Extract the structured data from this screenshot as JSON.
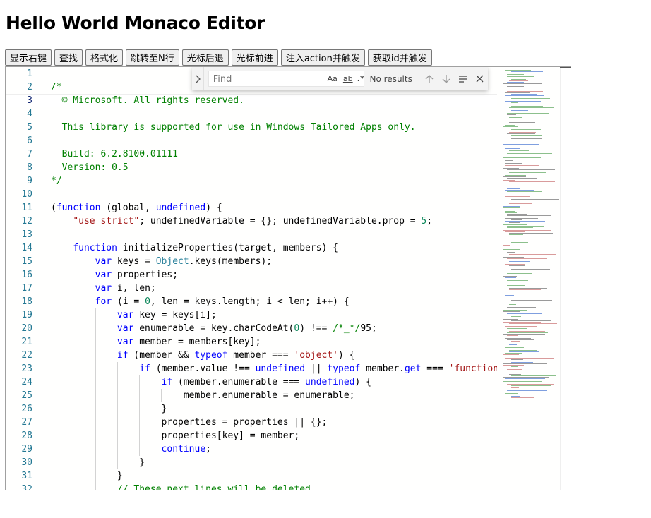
{
  "page": {
    "title": "Hello World Monaco Editor"
  },
  "toolbar": {
    "buttons": [
      {
        "label": "显示右键",
        "name": "show-context-menu-button"
      },
      {
        "label": "查找",
        "name": "find-button"
      },
      {
        "label": "格式化",
        "name": "format-button"
      },
      {
        "label": "跳转至N行",
        "name": "goto-line-button"
      },
      {
        "label": "光标后退",
        "name": "cursor-back-button"
      },
      {
        "label": "光标前进",
        "name": "cursor-forward-button"
      },
      {
        "label": "注入action并触发",
        "name": "inject-action-button"
      },
      {
        "label": "获取id并触发",
        "name": "get-id-trigger-button"
      }
    ]
  },
  "find_widget": {
    "placeholder": "Find",
    "match_case_label": "Aa",
    "whole_word_label": "ab",
    "regex_label": ".*",
    "result_text": "No results",
    "icons": [
      "chevron-right-icon",
      "arrow-up-icon",
      "arrow-down-icon",
      "selection-lines-icon",
      "close-icon"
    ]
  },
  "editor": {
    "language": "javascript",
    "current_line": 3,
    "lines": [
      {
        "n": "1",
        "indent": 0,
        "tokens": []
      },
      {
        "n": "2",
        "indent": 0,
        "tokens": [
          [
            "/*",
            "c"
          ]
        ]
      },
      {
        "n": "3",
        "indent": 0,
        "tokens": [
          [
            "  © Microsoft. All rights reserved.",
            "c"
          ]
        ]
      },
      {
        "n": "4",
        "indent": 0,
        "tokens": []
      },
      {
        "n": "5",
        "indent": 0,
        "tokens": [
          [
            "  This library is supported for use in Windows Tailored Apps only.",
            "c"
          ]
        ]
      },
      {
        "n": "6",
        "indent": 0,
        "tokens": []
      },
      {
        "n": "7",
        "indent": 0,
        "tokens": [
          [
            "  Build: 6.2.8100.01111",
            "c"
          ]
        ]
      },
      {
        "n": "8",
        "indent": 0,
        "tokens": [
          [
            "  Version: 0.5",
            "c"
          ]
        ]
      },
      {
        "n": "9",
        "indent": 0,
        "tokens": [
          [
            "*/",
            "c"
          ]
        ]
      },
      {
        "n": "10",
        "indent": 0,
        "tokens": []
      },
      {
        "n": "11",
        "indent": 0,
        "tokens": [
          [
            "(",
            ""
          ],
          [
            "function",
            "k"
          ],
          [
            " (global, ",
            ""
          ],
          [
            "undefined",
            "k"
          ],
          [
            ") {",
            ""
          ]
        ]
      },
      {
        "n": "12",
        "indent": 1,
        "tokens": [
          [
            "    ",
            ""
          ],
          [
            "\"use strict\"",
            "s"
          ],
          [
            "; undefinedVariable = {}; undefinedVariable.prop = ",
            ""
          ],
          [
            "5",
            "n"
          ],
          [
            ";",
            ""
          ]
        ]
      },
      {
        "n": "13",
        "indent": 1,
        "tokens": []
      },
      {
        "n": "14",
        "indent": 1,
        "tokens": [
          [
            "    ",
            ""
          ],
          [
            "function",
            "k"
          ],
          [
            " initializeProperties(target, members) {",
            ""
          ]
        ]
      },
      {
        "n": "15",
        "indent": 2,
        "tokens": [
          [
            "        ",
            ""
          ],
          [
            "var",
            "k"
          ],
          [
            " keys = ",
            ""
          ],
          [
            "Object",
            "t"
          ],
          [
            ".keys(members);",
            ""
          ]
        ]
      },
      {
        "n": "16",
        "indent": 2,
        "tokens": [
          [
            "        ",
            ""
          ],
          [
            "var",
            "k"
          ],
          [
            " properties;",
            ""
          ]
        ]
      },
      {
        "n": "17",
        "indent": 2,
        "tokens": [
          [
            "        ",
            ""
          ],
          [
            "var",
            "k"
          ],
          [
            " i, len;",
            ""
          ]
        ]
      },
      {
        "n": "18",
        "indent": 2,
        "tokens": [
          [
            "        ",
            ""
          ],
          [
            "for",
            "k"
          ],
          [
            " (i = ",
            ""
          ],
          [
            "0",
            "n"
          ],
          [
            ", len = keys.length; i < len; i++) {",
            ""
          ]
        ]
      },
      {
        "n": "19",
        "indent": 3,
        "tokens": [
          [
            "            ",
            ""
          ],
          [
            "var",
            "k"
          ],
          [
            " key = keys[i];",
            ""
          ]
        ]
      },
      {
        "n": "20",
        "indent": 3,
        "tokens": [
          [
            "            ",
            ""
          ],
          [
            "var",
            "k"
          ],
          [
            " enumerable = key.charCodeAt(",
            ""
          ],
          [
            "0",
            "n"
          ],
          [
            ") !== ",
            ""
          ],
          [
            "/*_*/",
            "c"
          ],
          [
            "95;",
            ""
          ]
        ]
      },
      {
        "n": "21",
        "indent": 3,
        "tokens": [
          [
            "            ",
            ""
          ],
          [
            "var",
            "k"
          ],
          [
            " member = members[key];",
            ""
          ]
        ]
      },
      {
        "n": "22",
        "indent": 3,
        "tokens": [
          [
            "            ",
            ""
          ],
          [
            "if",
            "k"
          ],
          [
            " (member && ",
            ""
          ],
          [
            "typeof",
            "k"
          ],
          [
            " member === ",
            ""
          ],
          [
            "'object'",
            "s"
          ],
          [
            ") {",
            ""
          ]
        ]
      },
      {
        "n": "23",
        "indent": 4,
        "tokens": [
          [
            "                ",
            ""
          ],
          [
            "if",
            "k"
          ],
          [
            " (member.value !== ",
            ""
          ],
          [
            "undefined",
            "k"
          ],
          [
            " || ",
            ""
          ],
          [
            "typeof",
            "k"
          ],
          [
            " member.",
            ""
          ],
          [
            "get",
            "k"
          ],
          [
            " === ",
            ""
          ],
          [
            "'function'",
            "s"
          ]
        ]
      },
      {
        "n": "24",
        "indent": 5,
        "tokens": [
          [
            "                    ",
            ""
          ],
          [
            "if",
            "k"
          ],
          [
            " (member.enumerable === ",
            ""
          ],
          [
            "undefined",
            "k"
          ],
          [
            ") {",
            ""
          ]
        ]
      },
      {
        "n": "25",
        "indent": 6,
        "tokens": [
          [
            "                        member.enumerable = enumerable;",
            ""
          ]
        ]
      },
      {
        "n": "26",
        "indent": 5,
        "tokens": [
          [
            "                    }",
            ""
          ]
        ]
      },
      {
        "n": "27",
        "indent": 5,
        "tokens": [
          [
            "                    properties = properties || {};",
            ""
          ]
        ]
      },
      {
        "n": "28",
        "indent": 5,
        "tokens": [
          [
            "                    properties[key] = member;",
            ""
          ]
        ]
      },
      {
        "n": "29",
        "indent": 5,
        "tokens": [
          [
            "                    ",
            ""
          ],
          [
            "continue",
            "k"
          ],
          [
            ";",
            ""
          ]
        ]
      },
      {
        "n": "30",
        "indent": 4,
        "tokens": [
          [
            "                }",
            ""
          ]
        ]
      },
      {
        "n": "31",
        "indent": 3,
        "tokens": [
          [
            "            }",
            ""
          ]
        ]
      },
      {
        "n": "32",
        "indent": 3,
        "tokens": [
          [
            "            ",
            ""
          ],
          [
            "// These next lines will be deleted",
            "c"
          ]
        ]
      }
    ]
  },
  "colors": {
    "comment": "#008000",
    "keyword": "#0000ff",
    "string": "#a31515",
    "number": "#098658",
    "type": "#267f99",
    "line_number": "#237893"
  }
}
